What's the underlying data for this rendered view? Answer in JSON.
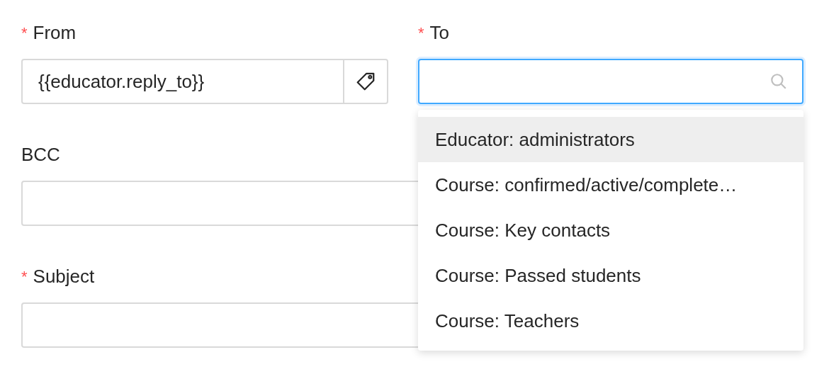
{
  "from": {
    "label": "From",
    "required_mark": "*",
    "value": "{{educator.reply_to}}"
  },
  "to": {
    "label": "To",
    "required_mark": "*",
    "focused": true
  },
  "bcc": {
    "label": "BCC"
  },
  "subject": {
    "label": "Subject",
    "required_mark": "*"
  },
  "to_options": [
    {
      "label": "Educator: administrators",
      "selected": true
    },
    {
      "label": "Course: confirmed/active/complete…",
      "selected": false
    },
    {
      "label": "Course: Key contacts",
      "selected": false
    },
    {
      "label": "Course: Passed students",
      "selected": false
    },
    {
      "label": "Course: Teachers",
      "selected": false
    }
  ]
}
